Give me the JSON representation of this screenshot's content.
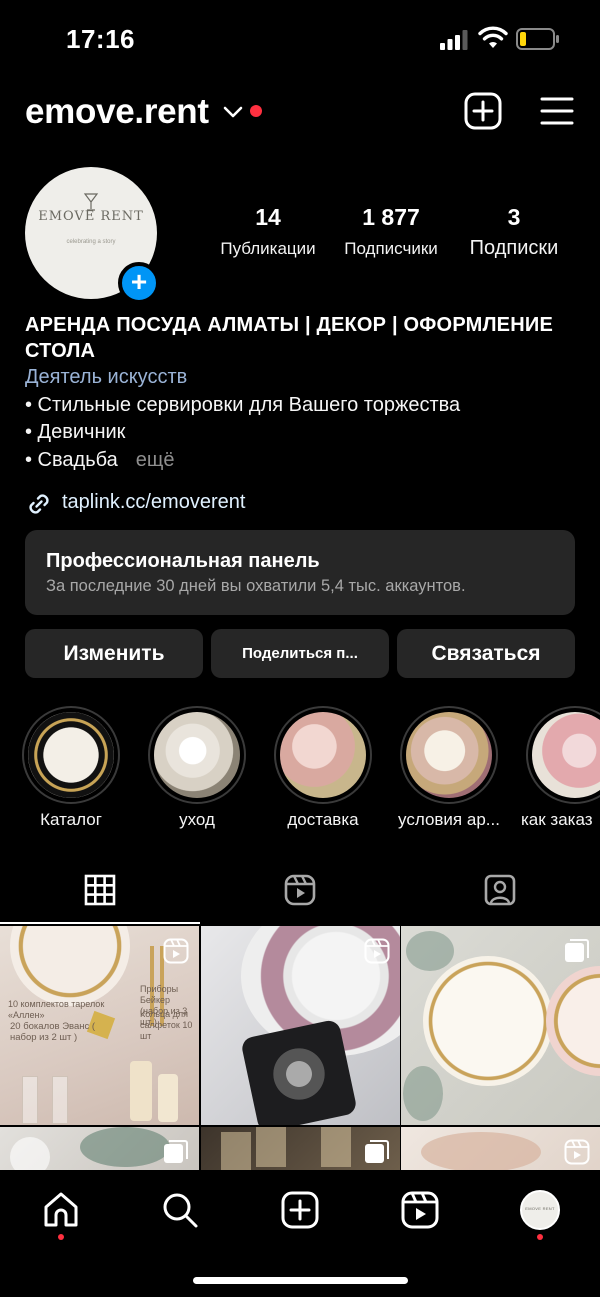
{
  "status_bar": {
    "time": "17:16"
  },
  "header": {
    "username": "emove.rent"
  },
  "avatar": {
    "logo_text": "EMOVE RENT",
    "logo_tagline": "celebrating a story"
  },
  "stats": [
    {
      "value": "14",
      "label": "Публикации"
    },
    {
      "value": "1 877",
      "label": "Подписчики"
    },
    {
      "value": "3",
      "label": "Подписки"
    }
  ],
  "bio": {
    "name": "АРЕНДА ПОСУДА АЛМАТЫ | ДЕКОР  |  ОФОРМЛЕНИЕ СТОЛА",
    "category": "Деятель искусств",
    "lines": [
      "• Стильные сервировки для Вашего торжества",
      "• Девичник",
      "• Свадьба"
    ],
    "more": "ещё",
    "link": "taplink.cc/emoverent"
  },
  "pro_panel": {
    "title": "Профессиональная панель",
    "subtitle": "За последние 30 дней вы охватили 5,4 тыс. аккаунтов."
  },
  "buttons": {
    "edit": "Изменить",
    "share": "Поделиться п...",
    "contact": "Связаться"
  },
  "highlights": [
    {
      "label": "Каталог"
    },
    {
      "label": "уход"
    },
    {
      "label": "доставка"
    },
    {
      "label": "условия ар..."
    },
    {
      "label": "как заказ"
    }
  ],
  "posts": {
    "p1": {
      "text1": "10 комплектов тарелок «Аллен»",
      "text2": "Приборы Бейкер (набор из 3 шт )",
      "text3": "Кольца для салфеток 10 шт",
      "text4": "20 бокалов Эванс ( набор из 2 шт )"
    }
  },
  "colors": {
    "background": "#000000",
    "surface": "#262626",
    "accent_blue": "#0095f6",
    "notification_red": "#ff3040",
    "category_link": "#9ab3d6"
  },
  "icons": [
    "signal-icon",
    "wifi-icon",
    "battery-icon",
    "chevron-down-icon",
    "add-post-icon",
    "menu-icon",
    "link-icon",
    "grid-icon",
    "reels-icon",
    "tagged-icon",
    "home-icon",
    "search-icon",
    "new-post-icon",
    "reels-nav-icon"
  ]
}
